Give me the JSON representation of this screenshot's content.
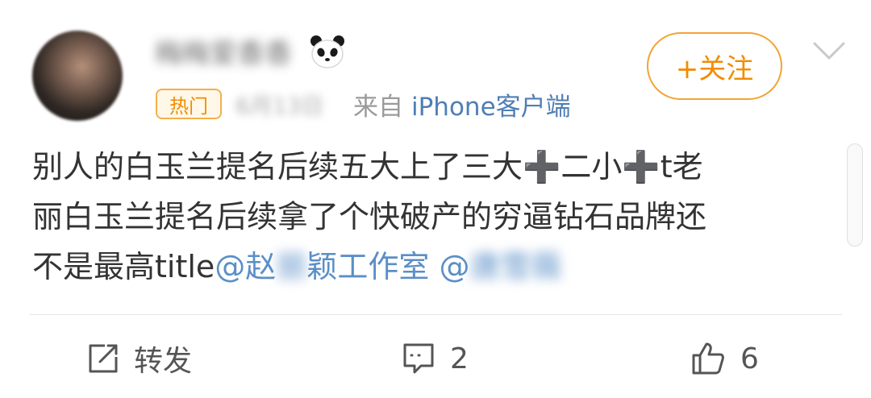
{
  "post": {
    "username": "梅梅爱香香",
    "badge": "热门",
    "time": "6月13日",
    "source_prefix": "来自",
    "source_app": "iPhone客户端",
    "follow_label": "+关注",
    "content": {
      "line1": "别人的白玉兰提名后续五大上了三大",
      "plus1": "➕",
      "line1b": "二小",
      "plus2": "➕",
      "line1c": "t老",
      "line2": "丽白玉兰提名后续拿了个快破产的穷逼钻石品牌还",
      "line3": "不是最高title",
      "mention1_visible_a": "@赵",
      "mention1_hidden": "丽",
      "mention1_visible_b": "颖工作室",
      "mention2_visible": "@",
      "mention2_hidden": "唐雪薇"
    }
  },
  "actions": {
    "repost_label": "转发",
    "comment_count": "2",
    "like_count": "6"
  },
  "icons": [
    "panda-icon",
    "chevron-down-icon",
    "repost-icon",
    "comment-icon",
    "like-icon"
  ],
  "colors": {
    "accent_orange": "#f28c00",
    "badge_border": "#f5b04a",
    "link_blue": "#5b8fc7",
    "text": "#333333"
  }
}
